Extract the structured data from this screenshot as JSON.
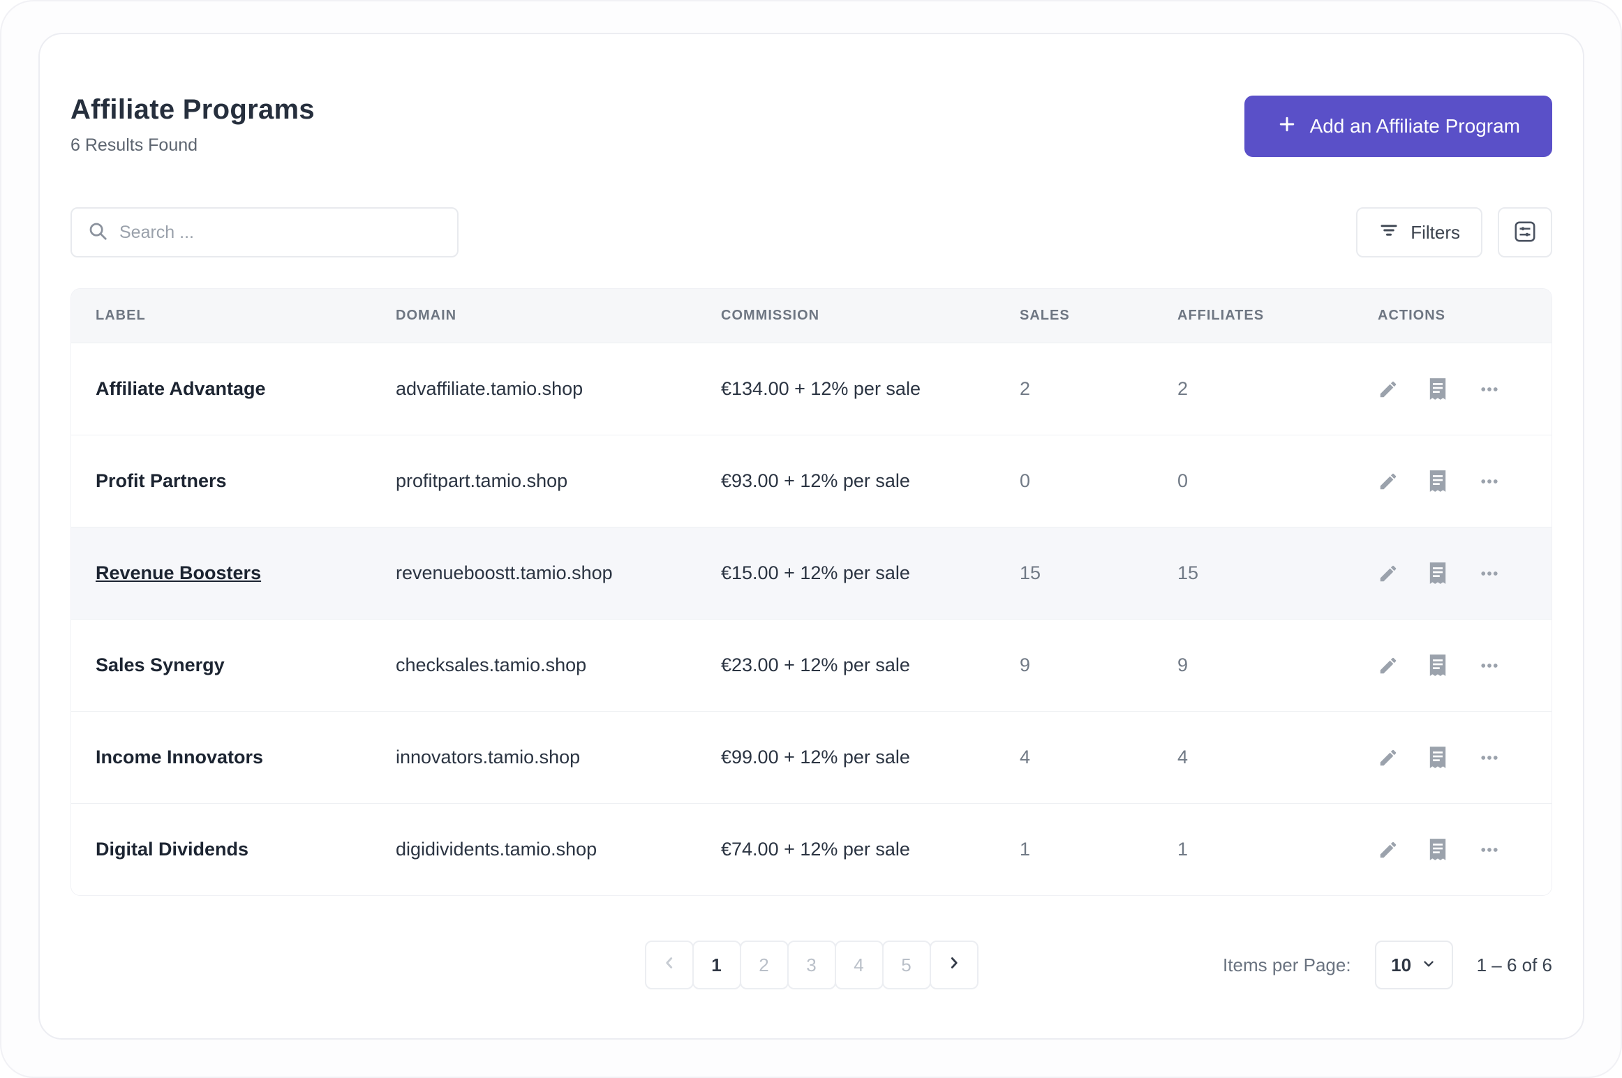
{
  "colors": {
    "accent": "#5a50c8"
  },
  "page": {
    "title": "Affiliate Programs",
    "results_summary": "6 Results Found"
  },
  "toolbar": {
    "add_button_label": "Add an Affiliate Program",
    "search_placeholder": "Search ...",
    "filters_label": "Filters"
  },
  "table": {
    "columns": [
      "LABEL",
      "DOMAIN",
      "COMMISSION",
      "SALES",
      "AFFILIATES",
      "ACTIONS"
    ],
    "hovered_row_index": 2,
    "rows": [
      {
        "label": "Affiliate Advantage",
        "domain": "advaffiliate.tamio.shop",
        "commission": "€134.00 + 12% per sale",
        "sales": "2",
        "affiliates": "2"
      },
      {
        "label": "Profit Partners",
        "domain": "profitpart.tamio.shop",
        "commission": "€93.00 + 12% per sale",
        "sales": "0",
        "affiliates": "0"
      },
      {
        "label": "Revenue Boosters",
        "domain": "revenueboostt.tamio.shop",
        "commission": "€15.00 + 12% per sale",
        "sales": "15",
        "affiliates": "15"
      },
      {
        "label": "Sales Synergy",
        "domain": "checksales.tamio.shop",
        "commission": "€23.00 + 12% per sale",
        "sales": "9",
        "affiliates": "9"
      },
      {
        "label": "Income Innovators",
        "domain": "innovators.tamio.shop",
        "commission": "€99.00 + 12% per sale",
        "sales": "4",
        "affiliates": "4"
      },
      {
        "label": "Digital Dividends",
        "domain": "digidividents.tamio.shop",
        "commission": "€74.00 + 12% per sale",
        "sales": "1",
        "affiliates": "1"
      }
    ]
  },
  "pagination": {
    "pages": [
      "1",
      "2",
      "3",
      "4",
      "5"
    ],
    "active_page": "1",
    "items_per_page_label": "Items per Page:",
    "items_per_page_value": "10",
    "range_text": "1 – 6 of 6"
  }
}
